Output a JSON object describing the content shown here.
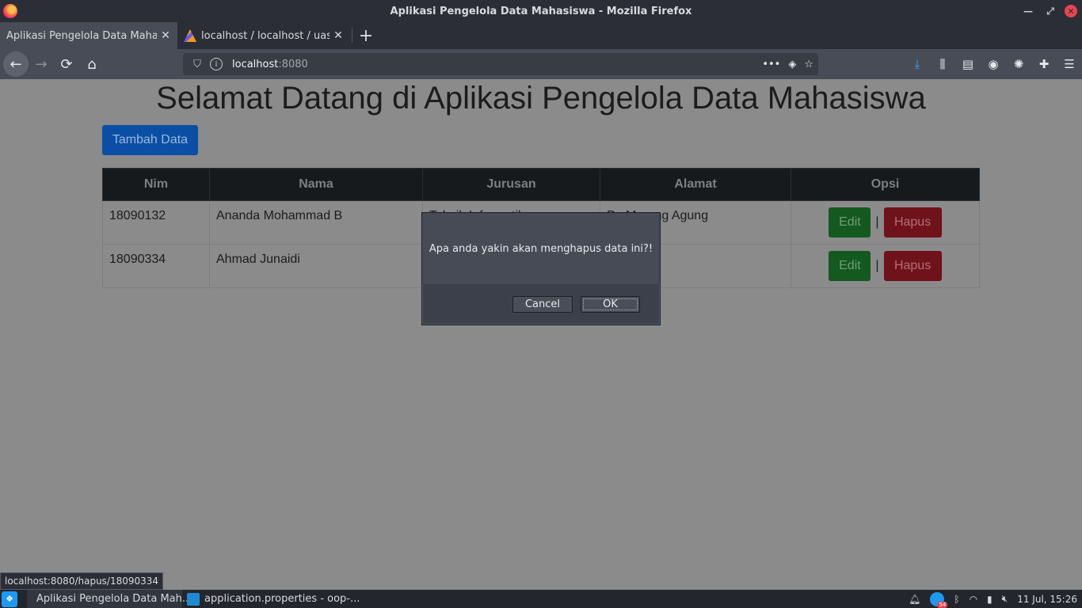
{
  "window": {
    "title": "Aplikasi Pengelola Data Mahasiswa - Mozilla Firefox"
  },
  "tabs": [
    {
      "label": "Aplikasi Pengelola Data Mahasiswa",
      "active": true
    },
    {
      "label": "localhost / localhost / uas_oop",
      "active": false
    }
  ],
  "url": {
    "host": "localhost",
    "port": ":8080"
  },
  "page": {
    "heading": "Selamat Datang di Aplikasi Pengelola Data Mahasiswa",
    "add_button": "Tambah Data",
    "table": {
      "headers": [
        "Nim",
        "Nama",
        "Jurusan",
        "Alamat",
        "Opsi"
      ],
      "rows": [
        {
          "nim": "18090132",
          "nama": "Ananda Mohammad B",
          "jurusan": "Teknik Informatika",
          "alamat": "Pe Marang Agung",
          "edit": "Edit",
          "hapus": "Hapus",
          "sep": "|"
        },
        {
          "nim": "18090334",
          "nama": "Ahmad Junaidi",
          "jurusan": "",
          "alamat": "",
          "edit": "Edit",
          "hapus": "Hapus",
          "sep": "|"
        }
      ]
    }
  },
  "dialog": {
    "message": "Apa anda yakin akan menghapus data ini?!",
    "cancel": "Cancel",
    "ok": "OK"
  },
  "status_link": "localhost:8080/hapus/18090334",
  "taskbar": {
    "items": [
      {
        "label": "Aplikasi Pengelola Data Mah...",
        "icon": "firefox-icon"
      },
      {
        "label": "application.properties - oop-...",
        "icon": "vscode-icon"
      }
    ],
    "clock": "11 Jul, 15:26",
    "notification_count": "54"
  },
  "colors": {
    "accent": "#1d99f3",
    "edit_green": "#14591f",
    "hapus_red": "#6f1219"
  }
}
